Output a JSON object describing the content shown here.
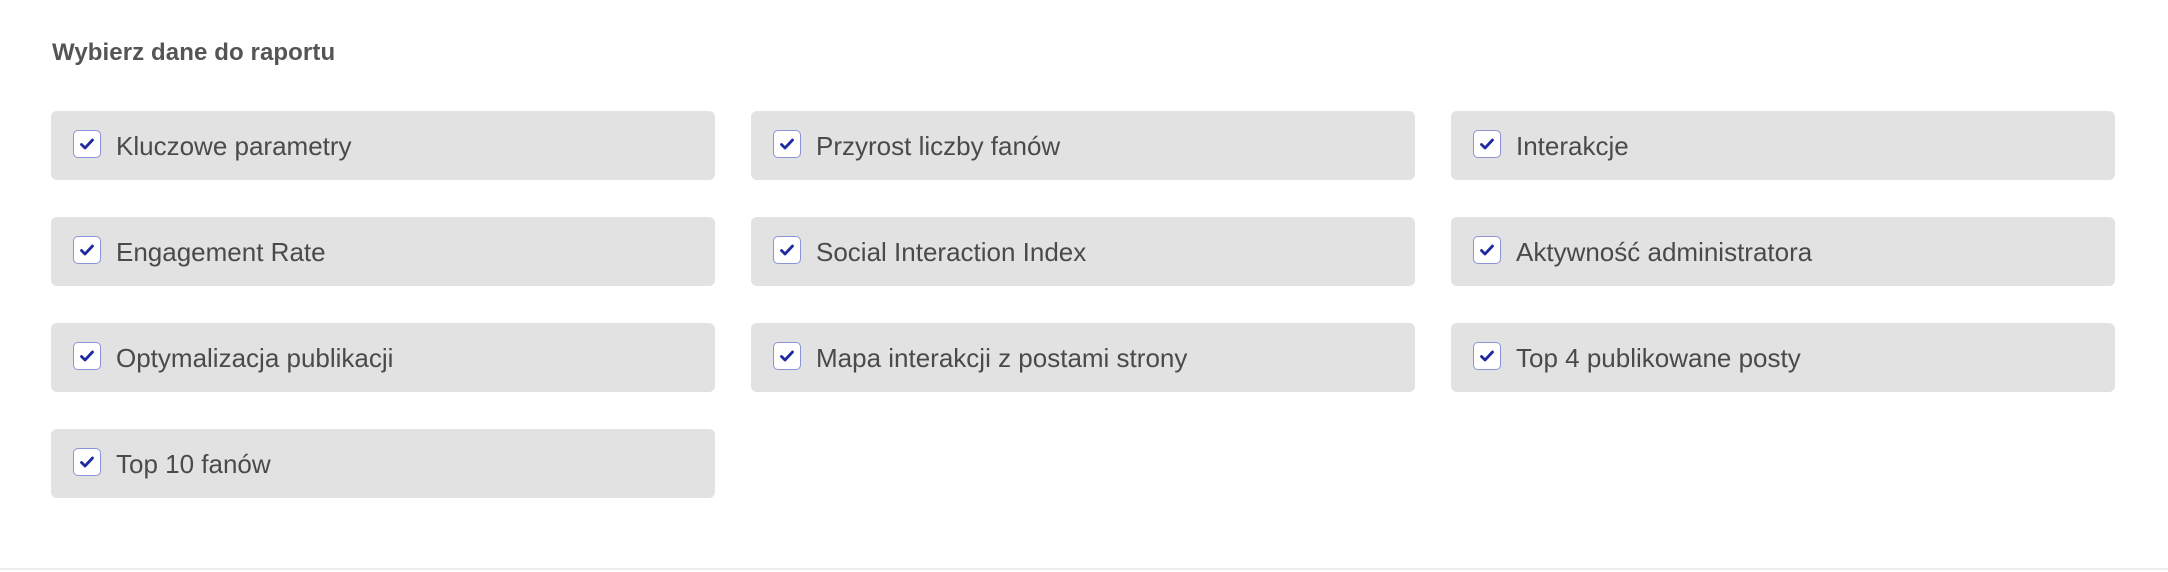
{
  "section": {
    "title": "Wybierz dane do raportu"
  },
  "colors": {
    "card_background": "#e2e2e2",
    "checkbox_border": "#8d93d9",
    "checkmark": "#1f2a9e",
    "label_text": "#4a4a4a",
    "title_text": "#555555"
  },
  "options": [
    {
      "label": "Kluczowe parametry",
      "checked": true,
      "icon": "checkmark-icon"
    },
    {
      "label": "Przyrost liczby fanów",
      "checked": true,
      "icon": "checkmark-icon"
    },
    {
      "label": "Interakcje",
      "checked": true,
      "icon": "checkmark-icon"
    },
    {
      "label": "Engagement Rate",
      "checked": true,
      "icon": "checkmark-icon"
    },
    {
      "label": "Social Interaction Index",
      "checked": true,
      "icon": "checkmark-icon"
    },
    {
      "label": "Aktywność administratora",
      "checked": true,
      "icon": "checkmark-icon"
    },
    {
      "label": "Optymalizacja publikacji",
      "checked": true,
      "icon": "checkmark-icon"
    },
    {
      "label": "Mapa interakcji z postami strony",
      "checked": true,
      "icon": "checkmark-icon"
    },
    {
      "label": "Top 4 publikowane posty",
      "checked": true,
      "icon": "checkmark-icon"
    },
    {
      "label": "Top 10 fanów",
      "checked": true,
      "icon": "checkmark-icon"
    }
  ]
}
